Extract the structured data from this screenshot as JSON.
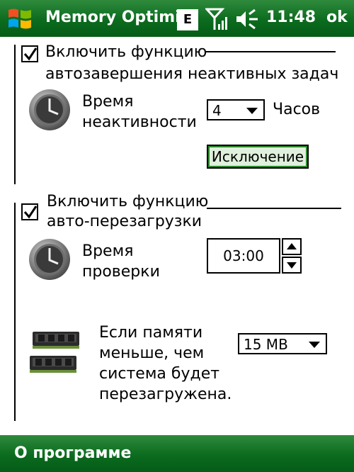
{
  "titlebar": {
    "title": "Memory Optimi:",
    "network_badge": "E",
    "time": "11:48",
    "ok_label": "ok",
    "icons": [
      "windows-start-icon",
      "signal-icon",
      "speaker-icon"
    ]
  },
  "section1": {
    "checkbox_checked": true,
    "heading_line1": "Включить функцию",
    "heading_line2": "автозавершения неактивных задач",
    "time_label_line1": "Время",
    "time_label_line2": "неактивности",
    "hours_value": "4",
    "hours_unit": "Часов",
    "exclusion_button": "Исключение"
  },
  "section2": {
    "checkbox_checked": true,
    "heading_line1": "Включить функцию",
    "heading_line2": "авто-перезагрузки",
    "check_label_line1": "Время",
    "check_label_line2": "проверки",
    "check_time": "03:00",
    "memory_label_line1": "Если памяти",
    "memory_label_line2": "меньше, чем",
    "memory_label_line3": "система будет",
    "memory_label_line4": "перезагружена.",
    "memory_value": "15 MB"
  },
  "softbar": {
    "left_label": "О программе"
  },
  "colors": {
    "bar_green": "#0b6b1e",
    "button_fill": "#dff0dc"
  }
}
